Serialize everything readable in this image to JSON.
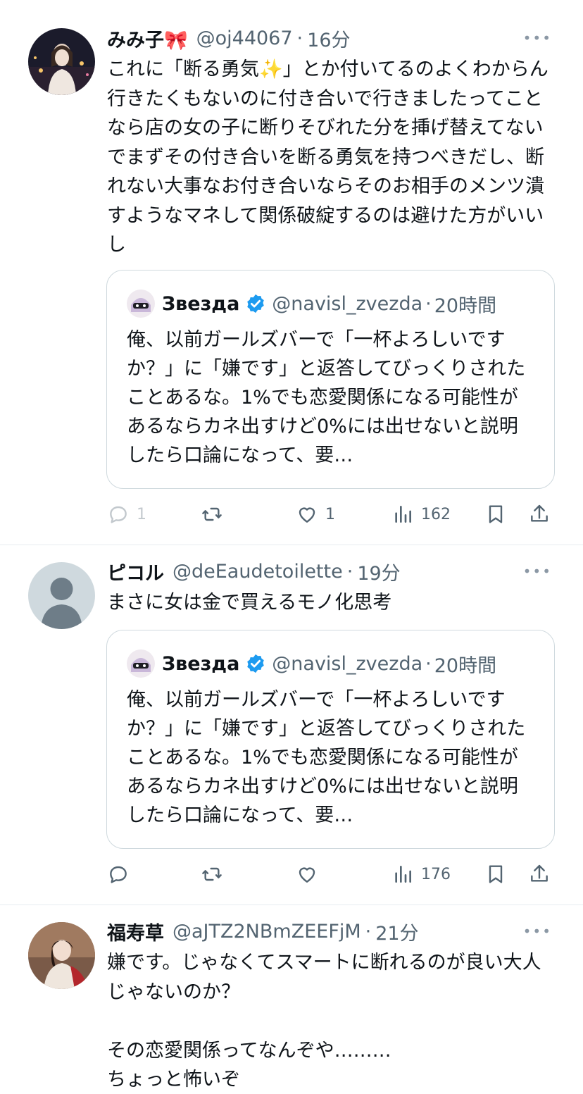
{
  "tweets": [
    {
      "name": "みみ子🎀",
      "handle": "@oj44067",
      "dot": "·",
      "time": "16分",
      "text": "これに「断る勇気✨」とか付いてるのよくわからん　行きたくもないのに付き合いで行きましたってことなら店の女の子に断りそびれた分を挿げ替えてないでまずその付き合いを断る勇気を持つべきだし、断れない大事なお付き合いならそのお相手のメンツ潰すようなマネして関係破綻するのは避けた方がいいし",
      "quote": {
        "name": "Звезда",
        "handle": "@navisl_zvezda",
        "dot": "·",
        "time": "20時間",
        "text": "俺、以前ガールズバーで「一杯よろしいですか？」に「嫌です」と返答してびっくりされたことあるな。1%でも恋愛関係になる可能性があるならカネ出すけど0%には出せないと説明したら口論になって、要…"
      },
      "actions": {
        "replies": "1",
        "retweets": "",
        "likes": "1",
        "views": "162"
      }
    },
    {
      "name": "ピコル",
      "handle": "@deEaudetoilette",
      "dot": "·",
      "time": "19分",
      "text": "まさに女は金で買えるモノ化思考",
      "quote": {
        "name": "Звезда",
        "handle": "@navisl_zvezda",
        "dot": "·",
        "time": "20時間",
        "text": "俺、以前ガールズバーで「一杯よろしいですか？」に「嫌です」と返答してびっくりされたことあるな。1%でも恋愛関係になる可能性があるならカネ出すけど0%には出せないと説明したら口論になって、要…"
      },
      "actions": {
        "replies": "",
        "retweets": "",
        "likes": "",
        "views": "176"
      }
    },
    {
      "name": "福寿草",
      "handle": "@aJTZ2NBmZEEFjM",
      "dot": "·",
      "time": "21分",
      "text": "嫌です。じゃなくてスマートに断れるのが良い大人じゃないのか？\n\nその恋愛関係ってなんぞや………\nちょっと怖いぞ"
    }
  ],
  "more_glyph": "•••",
  "colors": {
    "text": "#0f1419",
    "secondary": "#536471",
    "border": "#cfd9de",
    "verified": "#1d9bf0"
  }
}
